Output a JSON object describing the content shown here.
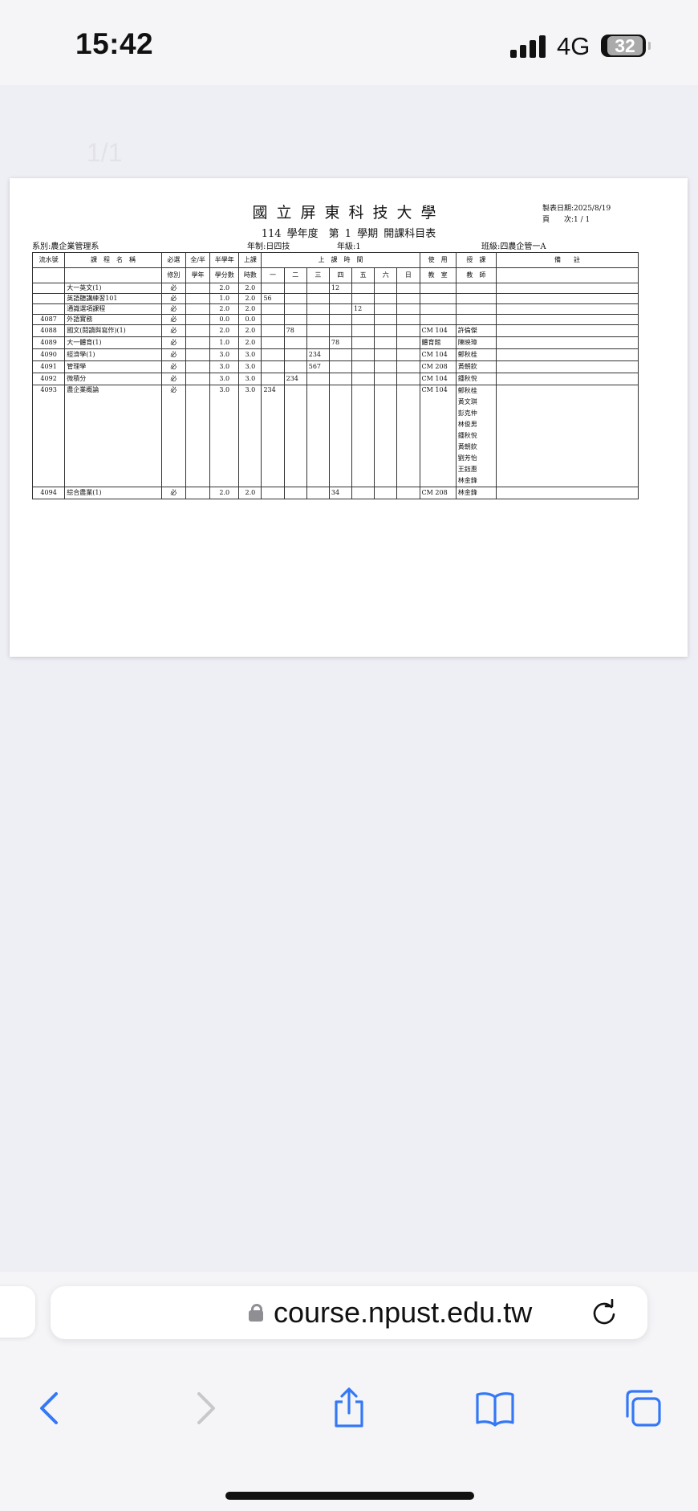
{
  "status_bar": {
    "time": "15:42",
    "network": "4G",
    "battery": "32"
  },
  "viewer": {
    "page_indicator": "1/1"
  },
  "document": {
    "title": "國立屏東科技大學",
    "subtitle": "114 學年度　第 1 學期 開課科目表",
    "print_date": "製表日期:2025/8/19",
    "page_no": "頁　　次:1 / 1",
    "department": "系別:農企業管理系",
    "system": "年制:日四技",
    "grade": "年級:1",
    "class": "班級:四農企管一A",
    "headers": {
      "serial": "流水號",
      "course": "課　程　名　稱",
      "req_top": "必選",
      "req_bottom": "修別",
      "full_top": "全/半",
      "full_bottom": "學年",
      "half_top": "半學年",
      "half_bottom": "學分數",
      "hours_top": "上課",
      "hours_bottom": "時數",
      "time": "上　課　時　間",
      "days": [
        "一",
        "二",
        "三",
        "四",
        "五",
        "六",
        "日"
      ],
      "room_top": "使　用",
      "room_bottom": "教　室",
      "teacher_top": "授　課",
      "teacher_bottom": "教　師",
      "note": "備　　註"
    },
    "rows": [
      {
        "serial": "",
        "name": "大一英文(1)",
        "req": "必",
        "credits": "2.0",
        "hours": "2.0",
        "days": [
          "",
          "",
          "",
          "12",
          "",
          "",
          ""
        ],
        "room": "",
        "teachers": []
      },
      {
        "serial": "",
        "name": "英語聽講練習101",
        "req": "必",
        "credits": "1.0",
        "hours": "2.0",
        "days": [
          "56",
          "",
          "",
          "",
          "",
          "",
          ""
        ],
        "room": "",
        "teachers": []
      },
      {
        "serial": "",
        "name": "通識選項課程",
        "req": "必",
        "credits": "2.0",
        "hours": "2.0",
        "days": [
          "",
          "",
          "",
          "",
          "12",
          "",
          ""
        ],
        "room": "",
        "teachers": []
      },
      {
        "serial": "4087",
        "name": "外語實務",
        "req": "必",
        "credits": "0.0",
        "hours": "0.0",
        "days": [
          "",
          "",
          "",
          "",
          "",
          "",
          ""
        ],
        "room": "",
        "teachers": []
      },
      {
        "serial": "4088",
        "name": "國文(閱讀與寫作)(1)",
        "req": "必",
        "credits": "2.0",
        "hours": "2.0",
        "days": [
          "",
          "78",
          "",
          "",
          "",
          "",
          ""
        ],
        "room": "CM 104",
        "teachers": [
          "許倫傑"
        ]
      },
      {
        "serial": "4089",
        "name": "大一體育(1)",
        "req": "必",
        "credits": "1.0",
        "hours": "2.0",
        "days": [
          "",
          "",
          "",
          "78",
          "",
          "",
          ""
        ],
        "room": "體育館",
        "teachers": [
          "陳映璋"
        ]
      },
      {
        "serial": "4090",
        "name": "經濟學(1)",
        "req": "必",
        "credits": "3.0",
        "hours": "3.0",
        "days": [
          "",
          "",
          "234",
          "",
          "",
          "",
          ""
        ],
        "room": "CM 104",
        "teachers": [
          "鄭秋桂"
        ]
      },
      {
        "serial": "4091",
        "name": "管理學",
        "req": "必",
        "credits": "3.0",
        "hours": "3.0",
        "days": [
          "",
          "",
          "567",
          "",
          "",
          "",
          ""
        ],
        "room": "CM 208",
        "teachers": [
          "黃朝欽"
        ]
      },
      {
        "serial": "4092",
        "name": "微積分",
        "req": "必",
        "credits": "3.0",
        "hours": "3.0",
        "days": [
          "",
          "234",
          "",
          "",
          "",
          "",
          ""
        ],
        "room": "CM 104",
        "teachers": [
          "鍾秋悅"
        ]
      },
      {
        "serial": "4093",
        "name": "農企業概論",
        "req": "必",
        "credits": "3.0",
        "hours": "3.0",
        "days": [
          "234",
          "",
          "",
          "",
          "",
          "",
          ""
        ],
        "room": "CM 104",
        "teachers": [
          "鄭秋桂",
          "黃文琪",
          "彭克仲",
          "林俊男",
          "鍾秋悅",
          "黃朝欽",
          "劉芳怡",
          "王鈺惠",
          "林金鋒"
        ]
      },
      {
        "serial": "4094",
        "name": "綜合農業(1)",
        "req": "必",
        "credits": "2.0",
        "hours": "2.0",
        "days": [
          "",
          "",
          "",
          "34",
          "",
          "",
          ""
        ],
        "room": "CM 208",
        "teachers": [
          "林金鋒"
        ]
      }
    ]
  },
  "browser": {
    "url": "course.npust.edu.tw"
  },
  "colors": {
    "accent": "#3478f6",
    "disabled": "#c7c7cc",
    "page_bg": "#eeeef5"
  }
}
